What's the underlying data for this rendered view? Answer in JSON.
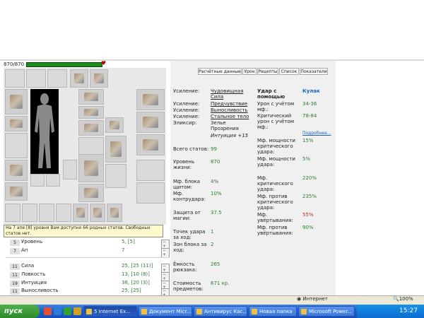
{
  "hp": {
    "text": "870/870",
    "fraction": 1.0
  },
  "tabs": [
    "Расчётные данные",
    "Урон",
    "Рецепты",
    "Список",
    "Показатели"
  ],
  "tooltip": "На 7 апе [8] уровня Вам доступно 66 родных статов. Свободных статов нет.",
  "stats": [
    {
      "num": "5",
      "name": "Уровень",
      "value": "5, [5]"
    },
    {
      "num": "7",
      "name": "Ап",
      "value": "7"
    },
    {
      "num": "11",
      "name": "Сила",
      "value": "25, [25 (11)]"
    },
    {
      "num": "11",
      "name": "Ловкость",
      "value": "13, [10 (8)]"
    },
    {
      "num": "19",
      "name": "Интуиция",
      "value": "36, [20 (3)]"
    },
    {
      "num": "11",
      "name": "Выносливость",
      "value": "25, [25]"
    }
  ],
  "mid": {
    "boosts": [
      {
        "label": "Усиление:",
        "value": "Чудовищная Сила"
      },
      {
        "label": "Усиление:",
        "value": "Предчувствие"
      },
      {
        "label": "Усиление:",
        "value": "Выносливость"
      },
      {
        "label": "Усиление:",
        "value": "Стальное тело"
      }
    ],
    "elixir_label": "Эликсир:",
    "elixir_value": "Зелье Прозрения",
    "elixir_note": "Интуиция +15",
    "rows": [
      {
        "label": "Всего статов:",
        "value": "99"
      },
      {
        "label": "Уровень жизни:",
        "value": "870"
      },
      {
        "label": "Мф. блока щитом:",
        "value": "4%"
      },
      {
        "label": "Мф. контрудара:",
        "value": "10%"
      },
      {
        "label": "Защита от магии:",
        "value": "37.5"
      },
      {
        "label": "Точек удара за ход:",
        "value": "1"
      },
      {
        "label": "Зон блока за ход:",
        "value": "2"
      },
      {
        "label": "Ёмкость рюкзака:",
        "value": "265"
      },
      {
        "label": "Стоимость предметов:",
        "value": "671 кр."
      }
    ]
  },
  "right": {
    "header_left": "Удар с помощью",
    "header_right": "Кулак",
    "rows": [
      {
        "label": "Урон с учётом мф.:",
        "value": "34-36"
      },
      {
        "label": "Критический урон с учётом мф.:",
        "value": "78-84"
      },
      {
        "label": "Мф. мощности критического удара:",
        "value": "15%"
      },
      {
        "label": "Мф. мощности удара:",
        "value": "5%"
      },
      {
        "label": "Мф. критического удара:",
        "value": "220%"
      },
      {
        "label": "Мф. против критического удара:",
        "value": "235%"
      },
      {
        "label": "Мф. увёртывания:",
        "value": "55%"
      },
      {
        "label": "Мф. против увёртывания:",
        "value": "90%"
      }
    ],
    "more_link": "Подробнее..."
  },
  "status": {
    "internet": "Интернет",
    "zoom": "100%"
  },
  "taskbar": {
    "start": "пуск",
    "buttons": [
      "5 Internet Ex...",
      "Документ Micr...",
      "Антивирус Кас...",
      "Новая папка",
      "Microsoft Power..."
    ],
    "clock": "15:27"
  },
  "colors": {
    "green": "#2e7d32",
    "red": "#c62828",
    "taskbar": "#1f59c9"
  }
}
